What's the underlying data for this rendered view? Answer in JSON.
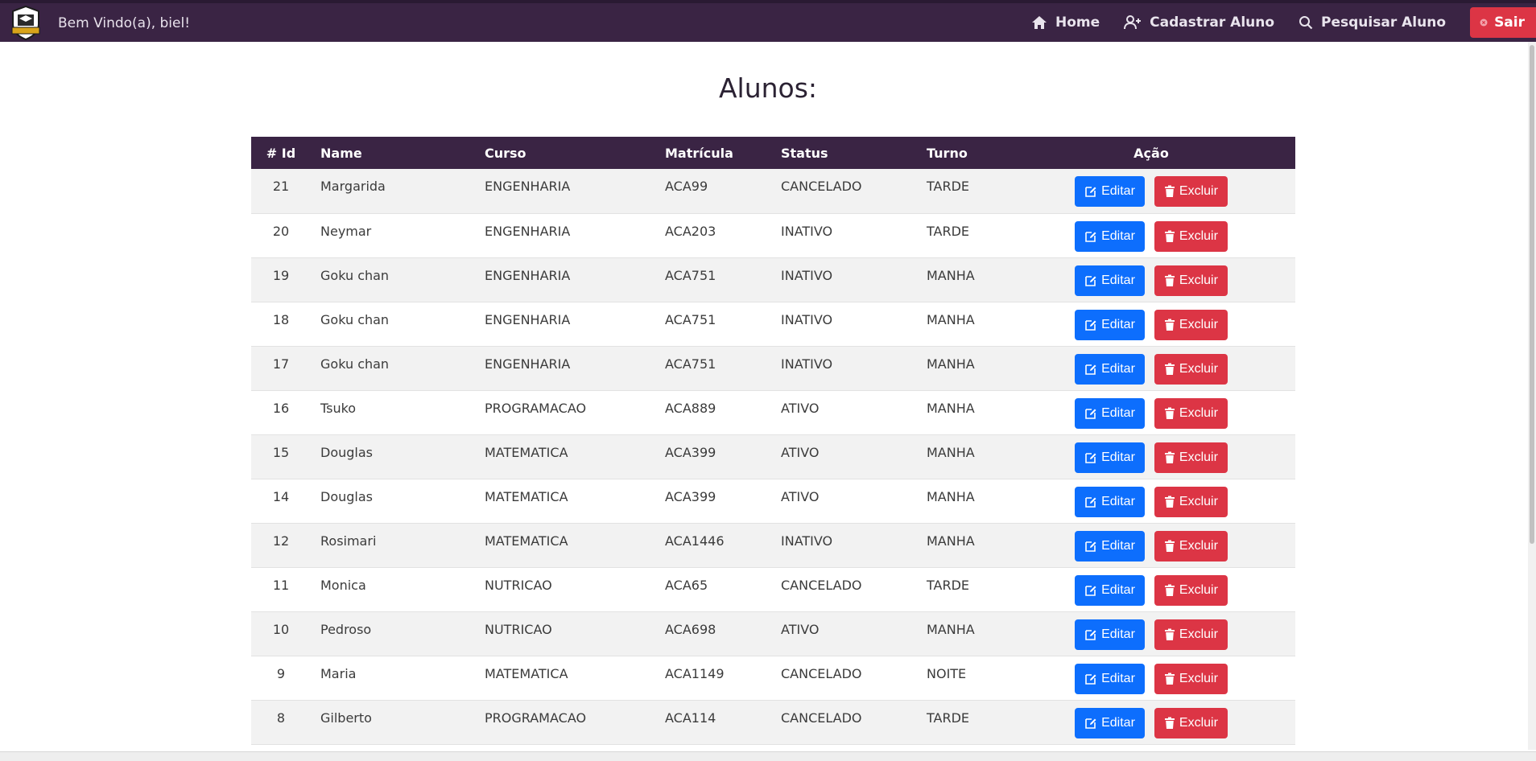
{
  "header": {
    "welcome": "Bem Vindo(a), biel!",
    "nav": {
      "home": "Home",
      "register": "Cadastrar Aluno",
      "search": "Pesquisar Aluno",
      "logout": "Sair"
    }
  },
  "page_title": "Alunos:",
  "table": {
    "headers": {
      "id": "# Id",
      "name": "Name",
      "course": "Curso",
      "enrollment": "Matrícula",
      "status": "Status",
      "shift": "Turno",
      "action": "Ação"
    },
    "edit_label": "Editar",
    "delete_label": "Excluir",
    "rows": [
      {
        "id": "21",
        "name": "Margarida",
        "course": "ENGENHARIA",
        "enrollment": "ACA99",
        "status": "CANCELADO",
        "shift": "TARDE"
      },
      {
        "id": "20",
        "name": "Neymar",
        "course": "ENGENHARIA",
        "enrollment": "ACA203",
        "status": "INATIVO",
        "shift": "TARDE"
      },
      {
        "id": "19",
        "name": "Goku chan",
        "course": "ENGENHARIA",
        "enrollment": "ACA751",
        "status": "INATIVO",
        "shift": "MANHA"
      },
      {
        "id": "18",
        "name": "Goku chan",
        "course": "ENGENHARIA",
        "enrollment": "ACA751",
        "status": "INATIVO",
        "shift": "MANHA"
      },
      {
        "id": "17",
        "name": "Goku chan",
        "course": "ENGENHARIA",
        "enrollment": "ACA751",
        "status": "INATIVO",
        "shift": "MANHA"
      },
      {
        "id": "16",
        "name": "Tsuko",
        "course": "PROGRAMACAO",
        "enrollment": "ACA889",
        "status": "ATIVO",
        "shift": "MANHA"
      },
      {
        "id": "15",
        "name": "Douglas",
        "course": "MATEMATICA",
        "enrollment": "ACA399",
        "status": "ATIVO",
        "shift": "MANHA"
      },
      {
        "id": "14",
        "name": "Douglas",
        "course": "MATEMATICA",
        "enrollment": "ACA399",
        "status": "ATIVO",
        "shift": "MANHA"
      },
      {
        "id": "12",
        "name": "Rosimari",
        "course": "MATEMATICA",
        "enrollment": "ACA1446",
        "status": "INATIVO",
        "shift": "MANHA"
      },
      {
        "id": "11",
        "name": "Monica",
        "course": "NUTRICAO",
        "enrollment": "ACA65",
        "status": "CANCELADO",
        "shift": "TARDE"
      },
      {
        "id": "10",
        "name": "Pedroso",
        "course": "NUTRICAO",
        "enrollment": "ACA698",
        "status": "ATIVO",
        "shift": "MANHA"
      },
      {
        "id": "9",
        "name": "Maria",
        "course": "MATEMATICA",
        "enrollment": "ACA1149",
        "status": "CANCELADO",
        "shift": "NOITE"
      },
      {
        "id": "8",
        "name": "Gilberto",
        "course": "PROGRAMACAO",
        "enrollment": "ACA114",
        "status": "CANCELADO",
        "shift": "TARDE"
      }
    ]
  },
  "colors": {
    "navbar": "#3a2444",
    "edit": "#0d6efd",
    "delete": "#dc3545"
  },
  "icons": {
    "logo": "college-shield-logo",
    "home": "home-icon",
    "register": "user-plus-icon",
    "search": "search-icon",
    "logout": "close-circle-icon",
    "edit": "edit-icon",
    "delete": "trash-icon"
  }
}
